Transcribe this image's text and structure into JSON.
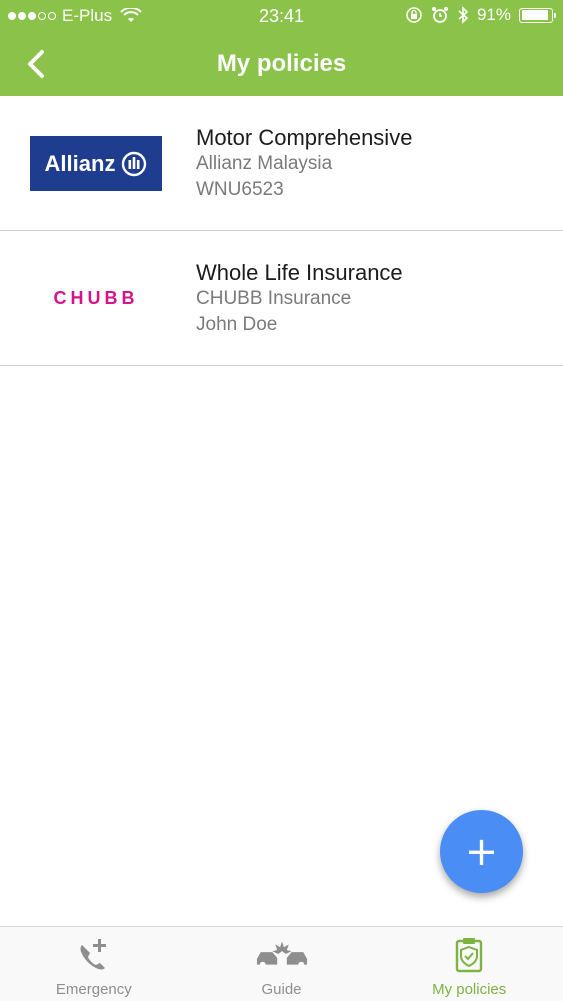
{
  "status_bar": {
    "carrier": "E-Plus",
    "time": "23:41",
    "battery": "91%",
    "battery_level": 0.91,
    "signal_bars_filled": 3,
    "signal_bars_total": 5
  },
  "nav": {
    "title": "My policies",
    "back_icon": "chevron-left-icon"
  },
  "policies": [
    {
      "name": "Motor Comprehensive",
      "company": "Allianz Malaysia",
      "detail": "WNU6523",
      "logo_text": "Allianz",
      "logo_color": "#1e3d8f"
    },
    {
      "name": "Whole Life Insurance",
      "company": "CHUBB Insurance",
      "detail": "John Doe",
      "logo_text": "CHUBB",
      "logo_color": "#d4148c"
    }
  ],
  "fab": {
    "label": "+"
  },
  "tabs": [
    {
      "label": "Emergency",
      "icon": "phone-plus-icon",
      "active": false
    },
    {
      "label": "Guide",
      "icon": "car-crash-icon",
      "active": false
    },
    {
      "label": "My policies",
      "icon": "clipboard-shield-icon",
      "active": true
    }
  ],
  "colors": {
    "accent": "#8bc34a",
    "fab": "#4a8df5",
    "active_tab": "#7cb342"
  }
}
